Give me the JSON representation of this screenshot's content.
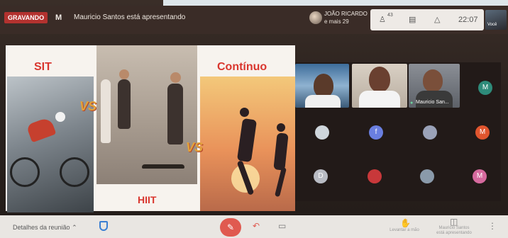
{
  "recording_badge": "GRAVANDO",
  "presenter": {
    "initial": "M",
    "text": "Mauricio Santos está apresentando"
  },
  "speaker": {
    "name": "JOÃO RICARDO",
    "more": "e mais 29"
  },
  "tray": {
    "participants_count": "43",
    "clock": "22:07"
  },
  "self_label": "Você",
  "slide": {
    "label_sit": "SIT",
    "label_continuo": "Contínuo",
    "label_hiit": "HIIT",
    "vs": "VS"
  },
  "participants": {
    "tile_name": "Mauricio San...",
    "avatars": [
      {
        "label": "M",
        "color": "#2e8b7a"
      },
      {
        "label": "",
        "color": "#cfd6dc"
      },
      {
        "label": "f",
        "color": "#6a7fe0"
      },
      {
        "label": "",
        "color": "#9aa2b8"
      },
      {
        "label": "M",
        "color": "#e0552e"
      },
      {
        "label": "D",
        "color": "#b9bcc4"
      },
      {
        "label": "",
        "color": "#c8383a"
      },
      {
        "label": "",
        "color": "#8a9aaa"
      },
      {
        "label": "M",
        "color": "#d66a9e"
      }
    ]
  },
  "bottom": {
    "details_label": "Detalhes da reunião",
    "raise_hand_label": "Levantar a mão",
    "presenting_label": "Mauricio Santos está apresentando"
  },
  "colors": {
    "recording": "#b3322f",
    "slide_title": "#d9362e",
    "mic_off": "#e05a50"
  }
}
